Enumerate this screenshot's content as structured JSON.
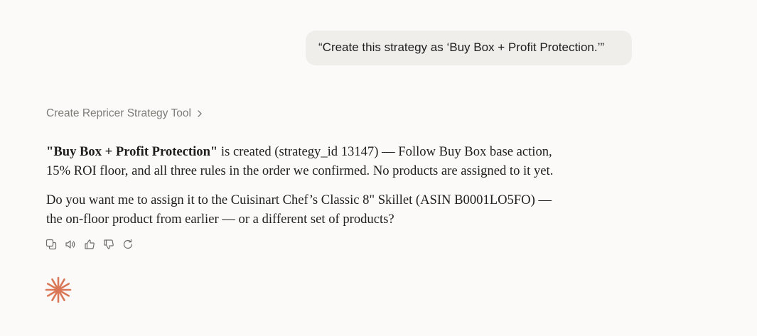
{
  "user_message": {
    "text": "“Create this strategy as ‘Buy Box + Profit Protection.’”"
  },
  "tool_call": {
    "label": "Create Repricer Strategy Tool",
    "icon": "chevron-right-icon"
  },
  "response": {
    "para1_bold": "\"Buy Box + Profit Protection\"",
    "para1_line1_rest": " is created (strategy_id 13147) — Follow Buy Box base action,",
    "para1_line2": "15% ROI floor, and all three rules in the order we confirmed. No products are assigned to it yet.",
    "para2_line1": "Do you want me to assign it to the Cuisinart Chef’s Classic 8\" Skillet (ASIN B0001LO5FO) —",
    "para2_line2": "the on-floor product from earlier — or a different set of products?"
  },
  "actions": [
    "copy-icon",
    "read-aloud-icon",
    "thumbs-up-icon",
    "thumbs-down-icon",
    "retry-icon"
  ],
  "colors": {
    "background": "#fbfaf8",
    "user_bubble": "#efeeeb",
    "logo": "#d97757",
    "muted_text": "#7d7b76"
  }
}
